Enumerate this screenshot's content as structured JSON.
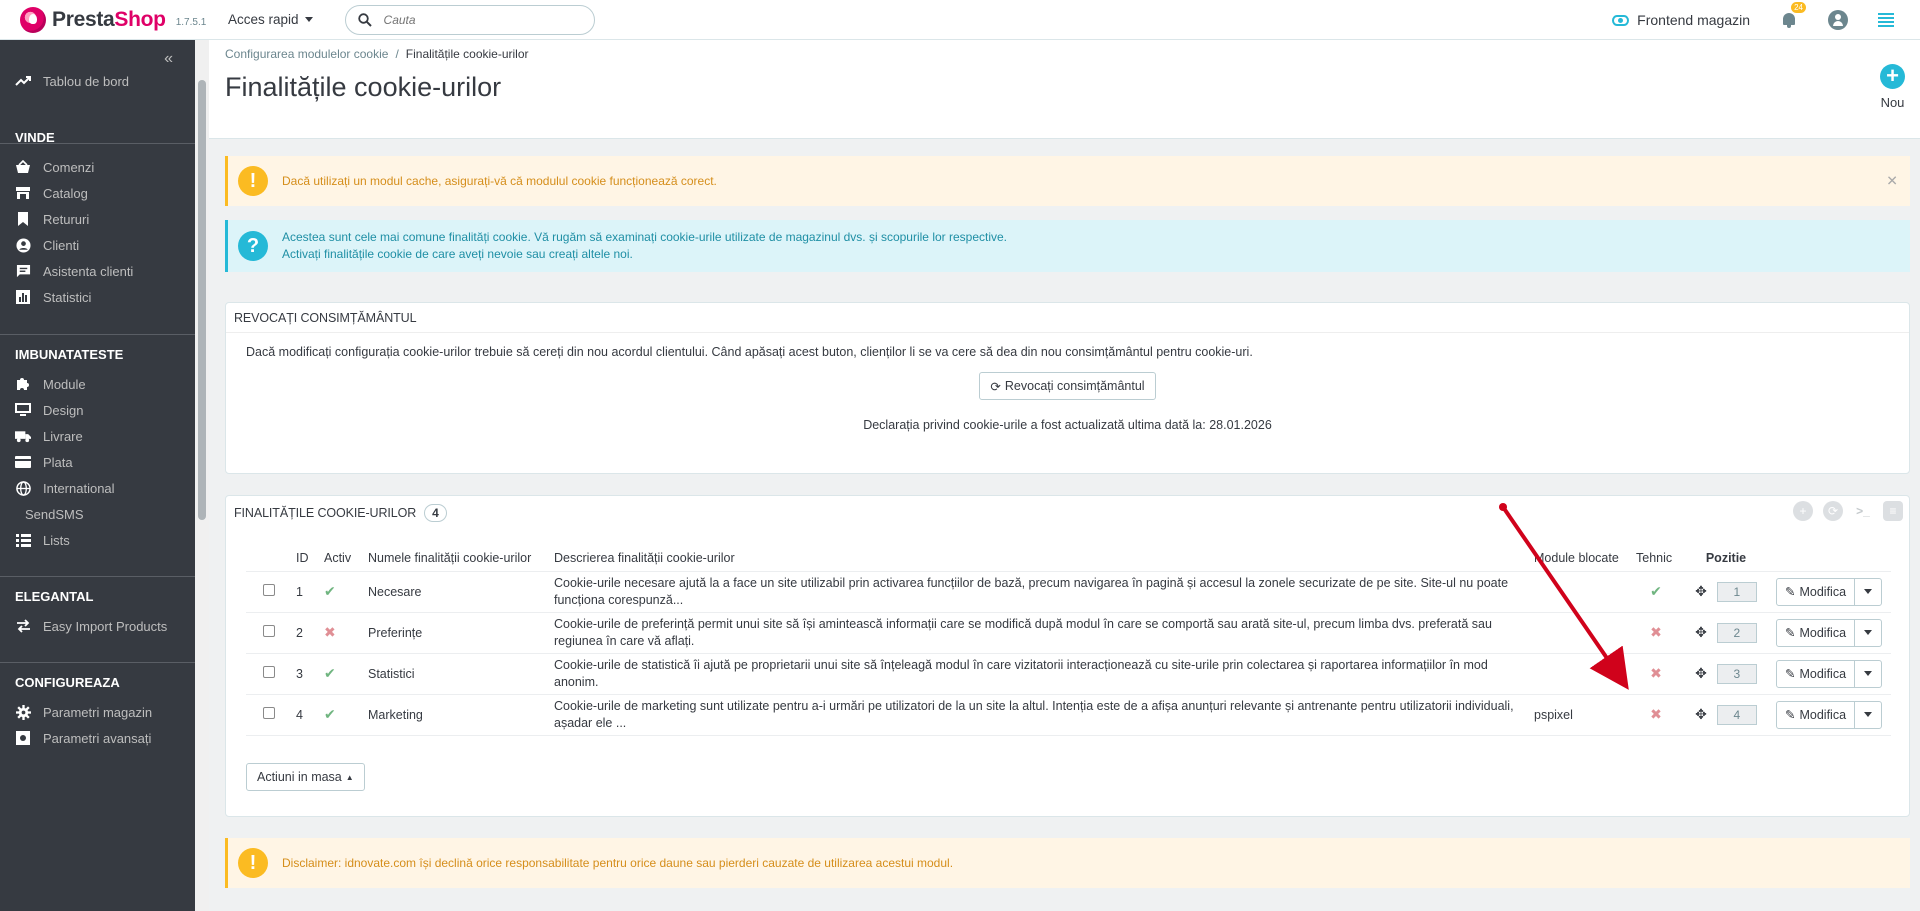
{
  "header": {
    "brand_pre": "Presta",
    "brand_post": "Shop",
    "version": "1.7.5.1",
    "quick_access": "Acces rapid",
    "search_placeholder": "Cauta",
    "frontend_label": "Frontend magazin",
    "notifications_count": "24"
  },
  "sidebar": {
    "dashboard": "Tablou de bord",
    "sections": {
      "sell": "VINDE",
      "improve": "IMBUNATATESTE",
      "elegantal": "ELEGANTAL",
      "configure": "CONFIGUREAZA"
    },
    "sell_items": [
      "Comenzi",
      "Catalog",
      "Retururi",
      "Clienti",
      "Asistenta clienti",
      "Statistici"
    ],
    "improve_items": [
      "Module",
      "Design",
      "Livrare",
      "Plata",
      "International",
      "SendSMS",
      "Lists"
    ],
    "elegantal_items": [
      "Easy Import Products"
    ],
    "configure_items": [
      "Parametri magazin",
      "Parametri avansați"
    ]
  },
  "page": {
    "breadcrumb_parent": "Configurarea modulelor cookie",
    "breadcrumb_current": "Finalitățile cookie-urilor",
    "title": "Finalitățile cookie-urilor",
    "new_label": "Nou"
  },
  "alerts": {
    "cache_warning": "Dacă utilizați un modul cache, asigurați-vă că modulul cookie funcționează corect.",
    "info_line1": "Acestea sunt cele mai comune finalități cookie. Vă rugăm să examinați cookie-urile utilizate de magazinul dvs. și scopurile lor respective.",
    "info_line2": "Activați finalitățile cookie de care aveți nevoie sau creați altele noi.",
    "disclaimer": "Disclaimer: idnovate.com își declină orice responsabilitate pentru orice daune sau pierderi cauzate de utilizarea acestui modul."
  },
  "revoke_panel": {
    "title": "REVOCAȚI CONSIMȚĂMÂNTUL",
    "text": "Dacă modificați configurația cookie-urilor trebuie să cereți din nou acordul clientului. Când apăsați acest buton, clienților li se va cere să dea din nou consimțământul pentru cookie-uri.",
    "button": "Revocați consimțământul",
    "updated": "Declarația privind cookie-urile a fost actualizată ultima dată la: 28.01.2026"
  },
  "list_panel": {
    "title": "FINALITĂȚILE COOKIE-URILOR",
    "count": "4",
    "columns": {
      "id": "ID",
      "active": "Activ",
      "name": "Numele finalității cookie-urilor",
      "description": "Descrierea finalității cookie-urilor",
      "blocked": "Module blocate",
      "technical": "Tehnic",
      "position": "Pozitie"
    },
    "rows": [
      {
        "id": "1",
        "active": true,
        "name": "Necesare",
        "description": "Cookie-urile necesare ajută la a face un site utilizabil prin activarea funcțiilor de bază, precum navigarea în pagină și accesul la zonele securizate de pe site. Site-ul nu poate funcționa corespunză...",
        "blocked": "",
        "technical": true,
        "position": "1",
        "action": "Modifica"
      },
      {
        "id": "2",
        "active": false,
        "name": "Preferințe",
        "description": "Cookie-urile de preferință permit unui site să își amintească informații care se modifică după modul în care se comportă sau arată site-ul, precum limba dvs. preferată sau regiunea în care vă aflați.",
        "blocked": "",
        "technical": false,
        "position": "2",
        "action": "Modifica"
      },
      {
        "id": "3",
        "active": true,
        "name": "Statistici",
        "description": "Cookie-urile de statistică îi ajută pe proprietarii unui site să înțeleagă modul în care vizitatorii interacționează cu site-urile prin colectarea și raportarea informațiilor în mod anonim.",
        "blocked": "",
        "technical": false,
        "position": "3",
        "action": "Modifica"
      },
      {
        "id": "4",
        "active": true,
        "name": "Marketing",
        "description": "Cookie-urile de marketing sunt utilizate pentru a-i urmări pe utilizatori de la un site la altul. Intenția este de a afișa anunțuri relevante și antrenante pentru utilizatorii individuali, așadar ele ...",
        "blocked": "pspixel",
        "technical": false,
        "position": "4",
        "action": "Modifica"
      }
    ],
    "bulk_actions": "Actiuni in masa"
  },
  "colors": {
    "sidebar_bg": "#363a41",
    "accent": "#25b9d7",
    "warning": "#fbbb22",
    "success": "#70b580",
    "danger": "#e08f95",
    "annotation_arrow": "#d0021b"
  }
}
